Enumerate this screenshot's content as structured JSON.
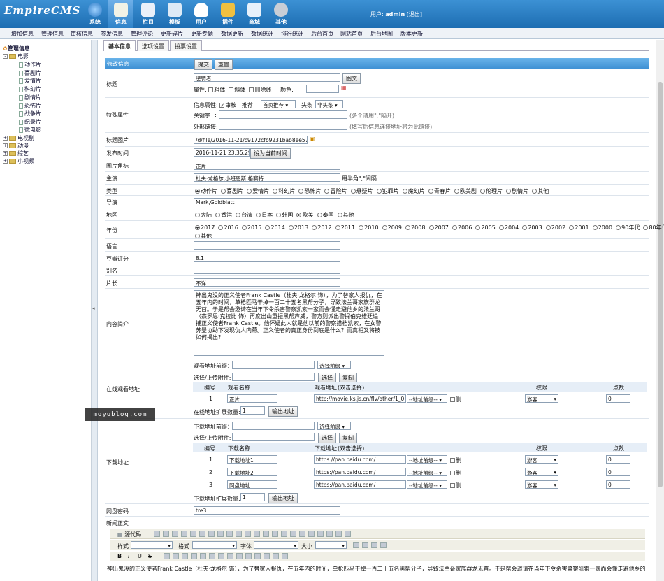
{
  "app": {
    "logo": "EmpireCMS",
    "user_label": "用户:",
    "user": "admin",
    "logout": "[退出]"
  },
  "top_nav": [
    {
      "label": "系统",
      "icon": "globe-icon"
    },
    {
      "label": "信息",
      "icon": "edit-icon"
    },
    {
      "label": "栏目",
      "icon": "folder-icon"
    },
    {
      "label": "模板",
      "icon": "template-icon"
    },
    {
      "label": "用户",
      "icon": "user-icon"
    },
    {
      "label": "插件",
      "icon": "plugin-icon"
    },
    {
      "label": "商城",
      "icon": "shop-icon"
    },
    {
      "label": "其他",
      "icon": "gear-icon"
    }
  ],
  "menubar": [
    "增加信息",
    "管理信息",
    "审核信息",
    "签发信息",
    "管理评论",
    "更新碎片",
    "更新专题",
    "数据更新",
    "数据统计",
    "排行统计",
    "后台首页",
    "网站首页",
    "后台地图",
    "版本更新"
  ],
  "sidebar": {
    "title": "管理信息",
    "movie": "电影",
    "movie_children": [
      "动作片",
      "喜剧片",
      "爱情片",
      "科幻片",
      "剧情片",
      "恐怖片",
      "战争片",
      "纪录片",
      "微电影"
    ],
    "others": [
      "电视剧",
      "动漫",
      "综艺",
      "小视频"
    ]
  },
  "tabs": [
    "基本信息",
    "选项设置",
    "投票设置"
  ],
  "form": {
    "header": "修改信息",
    "submit": "提交",
    "reset": "重置",
    "title_label": "标题",
    "title_value": "惩罚者",
    "pic_button": "图文",
    "attr_label": "属性:",
    "bold": "粗体",
    "italic": "斜体",
    "strike": "删除线",
    "color": "颜色:",
    "special_label": "特殊属性",
    "info_attr": "信息属性:",
    "audit": "审核",
    "recommend": "推荐",
    "recommend_value": "首页推荐",
    "headline": "头条",
    "headline_value": "非头条",
    "keyword": "关键字",
    "keyword_hint": "(多个请用\",\"隔开)",
    "outlink": "外部链接:",
    "outlink_hint": "(填写后信息连接地址将为此链接)",
    "titlepic_label": "标题图片",
    "titlepic_value": "/d/file/2016-11-21/c9172cfb9231bab8ee57f",
    "time_label": "发布时间",
    "time_value": "2016-11-21 23:35:29",
    "time_button": "设为当前时间",
    "corner_label": "图片角标",
    "corner_value": "正片",
    "actor_label": "主演",
    "actor_value": "杜夫·龙格尔,小班恩斯·格赛特",
    "actor_hint": "用半角\",\"间隔",
    "type_label": "类型",
    "types": [
      "动作片",
      "喜剧片",
      "爱情片",
      "科幻片",
      "恐怖片",
      "冒险片",
      "悬疑片",
      "犯罪片",
      "魔幻片",
      "青春片",
      "欧美剧",
      "伦理片",
      "剧情片",
      "其他"
    ],
    "director_label": "导演",
    "director_value": "Mark,Goldblatt",
    "region_label": "地区",
    "regions": [
      "大陆",
      "香港",
      "台湾",
      "日本",
      "韩国",
      "欧美",
      "泰国",
      "其他"
    ],
    "year_label": "年份",
    "years": [
      "2017",
      "2016",
      "2015",
      "2014",
      "2013",
      "2012",
      "2011",
      "2010",
      "2009",
      "2008",
      "2007",
      "2006",
      "2005",
      "2004",
      "2003",
      "2002",
      "2001",
      "2000",
      "90年代",
      "80年代"
    ],
    "year_other": "其他",
    "lang_label": "语言",
    "rating_label": "豆瓣评分",
    "rating_value": "8.1",
    "alias_label": "别名",
    "length_label": "片长",
    "length_value": "不详",
    "intro_label": "内容简介",
    "intro_text": "神出鬼没的正义使者Frank Castle（杜夫·龙格尔 饰），为了替家人报仇，在五年内的时间，单枪匹马干掉一百二十五名黑帮分子，导致法兰哥家族群龙无首。于是帮会邀请在当年下令杀害警察凯索一家而会懂走避他乡的法兰哥（杰罗恩·克拉比 饰）再度出山重振黑帮声威，警方则派出警探伯克维廷追捕正义使者Frank Castle。他怀疑此人就是他以前的警察搭档凯索，在女警苏曼协助下发现仇人内幕。正义使者的真正身份到底是什么？而真相又将被如何揭出?",
    "online_label": "在线观看地址",
    "play_prefix": "观看地址前缀：",
    "prefix_select": "选择前缀",
    "upload": "选择/上传附件:",
    "choose": "选择",
    "copy": "复制",
    "play_headers": [
      "编号",
      "观看名称",
      "观看地址",
      "(双击选择)",
      "权限",
      "点数"
    ],
    "play_rows": [
      {
        "no": "1",
        "name": "正片",
        "url": "http://movie.ks.js.cn/flv/other/1_0.m",
        "prefix": "--地址前缀--",
        "del": "删",
        "perm": "游客",
        "points": "0"
      }
    ],
    "play_ext": "在线地址扩展数量:",
    "play_ext_value": "1",
    "play_ext_button": "输出地址",
    "down_label": "下载地址",
    "down_prefix": "下载地址前缀：",
    "down_headers": [
      "编号",
      "下载名称",
      "下载地址",
      "(双击选择)",
      "权限",
      "点数"
    ],
    "down_rows": [
      {
        "no": "1",
        "name": "下载地址1",
        "url": "https://pan.baidu.com/",
        "prefix": "--地址前缀--",
        "del": "删",
        "perm": "游客",
        "points": "0"
      },
      {
        "no": "2",
        "name": "下载地址2",
        "url": "https://pan.baidu.com/",
        "prefix": "--地址前缀--",
        "del": "删",
        "perm": "游客",
        "points": "0"
      },
      {
        "no": "3",
        "name": "网盘地址",
        "url": "https://pan.baidu.com/",
        "prefix": "--地址前缀--",
        "del": "删",
        "perm": "游客",
        "points": "0"
      }
    ],
    "down_ext": "下载地址扩展数量:",
    "down_ext_value": "1",
    "down_ext_button": "输出地址",
    "pan_label": "网盘密码",
    "pan_value": "tre3",
    "body_label": "新闻正文",
    "editor_source": "源代码",
    "editor_style": "样式",
    "editor_format": "格式",
    "editor_font": "字体",
    "editor_size": "大小",
    "editor_text": "神出鬼没的正义使者Frank Castle（杜夫·龙格尔 饰），为了替家人报仇，在五年内的时间，单枪匹马干掉一百二十五名黑帮分子，导致法兰哥家族群龙无首。于是帮会邀请在当年下令杀害警察凯索一家而会懂走避他乡的法兰哥"
  },
  "watermark": "moyublog.com"
}
